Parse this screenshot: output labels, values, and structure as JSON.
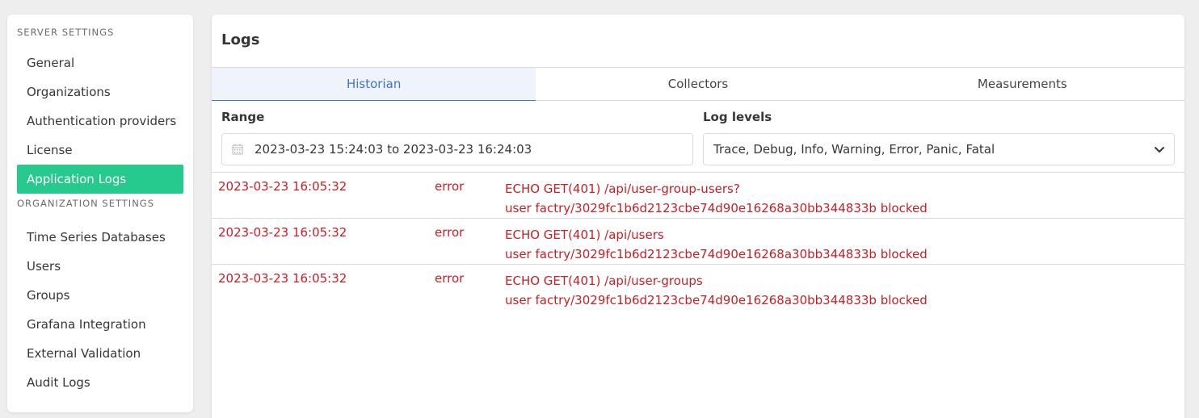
{
  "sidebar": {
    "server_heading": "SERVER SETTINGS",
    "server_items": [
      {
        "label": "General"
      },
      {
        "label": "Organizations"
      },
      {
        "label": "Authentication providers"
      },
      {
        "label": "License"
      },
      {
        "label": "Application Logs",
        "active": true
      }
    ],
    "org_heading": "ORGANIZATION SETTINGS",
    "org_items": [
      {
        "label": "Time Series Databases"
      },
      {
        "label": "Users"
      },
      {
        "label": "Groups"
      },
      {
        "label": "Grafana Integration"
      },
      {
        "label": "External Validation"
      },
      {
        "label": "Audit Logs"
      }
    ],
    "active_color": "#26c98e"
  },
  "main": {
    "title": "Logs",
    "tabs": [
      {
        "label": "Historian",
        "active": true
      },
      {
        "label": "Collectors"
      },
      {
        "label": "Measurements"
      }
    ],
    "range": {
      "label": "Range",
      "value": "2023-03-23 15:24:03 to 2023-03-23 16:24:03",
      "icon": "calendar-icon"
    },
    "log_levels": {
      "label": "Log levels",
      "value": "Trace, Debug, Info, Warning, Error, Panic, Fatal",
      "icon": "chevron-down-icon"
    },
    "logs": [
      {
        "timestamp": "2023-03-23 16:05:32",
        "level": "error",
        "line1": "ECHO GET(401) /api/user-group-users?",
        "line2": "user factry/3029fc1b6d2123cbe74d90e16268a30bb344833b blocked"
      },
      {
        "timestamp": "2023-03-23 16:05:32",
        "level": "error",
        "line1": "ECHO GET(401) /api/users",
        "line2": "user factry/3029fc1b6d2123cbe74d90e16268a30bb344833b blocked"
      },
      {
        "timestamp": "2023-03-23 16:05:32",
        "level": "error",
        "line1": "ECHO GET(401) /api/user-groups",
        "line2": "user factry/3029fc1b6d2123cbe74d90e16268a30bb344833b blocked"
      }
    ],
    "error_color": "#c52026",
    "accent_color": "#3d74d6"
  }
}
